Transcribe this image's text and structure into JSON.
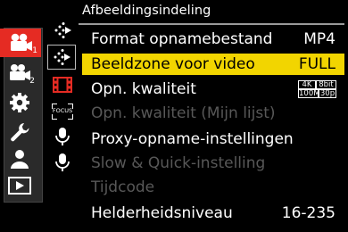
{
  "header": {
    "title": "Afbeeldingsindeling"
  },
  "main_tabs": [
    {
      "name": "video-camera-1",
      "badge": "1",
      "active": true
    },
    {
      "name": "video-camera-2",
      "badge": "2",
      "active": false
    },
    {
      "name": "gear-custom",
      "active": false
    },
    {
      "name": "wrench-setup",
      "active": false
    },
    {
      "name": "person-mymenu",
      "active": false
    },
    {
      "name": "playback",
      "active": false
    }
  ],
  "sub_tabs": [
    {
      "name": "image-format-page-1",
      "active": false
    },
    {
      "name": "image-format-page-2",
      "active": true
    },
    {
      "name": "film-strip",
      "active": false
    },
    {
      "name": "focus",
      "label": "FOCUS",
      "active": false
    },
    {
      "name": "microphone",
      "active": false
    },
    {
      "name": "microphone-2",
      "active": false
    }
  ],
  "menu": {
    "items": [
      {
        "label": "Format opnamebestand",
        "value": "MP4",
        "state": "normal"
      },
      {
        "label": "Beeldzone voor video",
        "value": "FULL",
        "state": "selected"
      },
      {
        "label": "Opn. kwaliteit",
        "value": "",
        "state": "normal",
        "quality": {
          "a": "4K",
          "b": "8bit",
          "c": "100M",
          "d": "30p"
        }
      },
      {
        "label": "Opn. kwaliteit (Mijn lijst)",
        "value": "",
        "state": "disabled"
      },
      {
        "label": "Proxy-opname-instellingen",
        "value": "",
        "state": "normal"
      },
      {
        "label": "Slow & Quick-instelling",
        "value": "",
        "state": "disabled"
      },
      {
        "label": "Tijdcode",
        "value": "",
        "state": "disabled"
      },
      {
        "label": "Helderheidsniveau",
        "value": "16-235",
        "state": "normal"
      }
    ]
  },
  "colors": {
    "accent": "#e52b23",
    "selection": "#f2d500",
    "disabled_text": "#585858"
  }
}
